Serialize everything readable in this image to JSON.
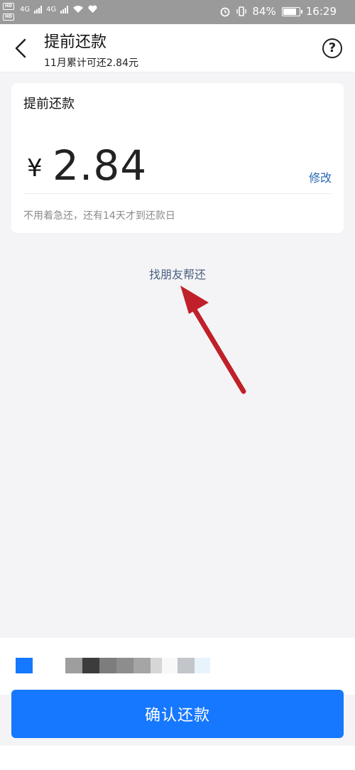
{
  "status_bar": {
    "hd1": "HD",
    "hd2": "HD",
    "net1": "4G",
    "net2": "4G",
    "battery_percent": "84%",
    "battery_level": 0.84,
    "time": "16:29"
  },
  "header": {
    "title": "提前还款",
    "subtitle": "11月累计可还2.84元",
    "help_symbol": "?"
  },
  "card": {
    "title": "提前还款",
    "currency": "¥",
    "amount": "2.84",
    "edit_label": "修改",
    "hint": "不用着急还，还有14天才到还款日"
  },
  "friend_link": "找朋友帮还",
  "confirm_button": "确认还款",
  "colors": {
    "primary": "#1677ff",
    "link": "#2866b5",
    "annotation_arrow": "#c0202a"
  }
}
